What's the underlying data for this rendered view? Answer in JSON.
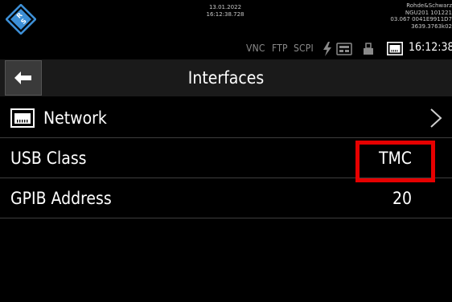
{
  "status_bar": {
    "capture_date": "13.01.2022",
    "capture_time": "16:12:38.728",
    "device_info": [
      "Rohde&Schwarz",
      "NGU201 101221",
      "03.067 0041E9911D7",
      "3639.3763k02"
    ],
    "remote_labels": [
      "VNC",
      "FTP",
      "SCPI"
    ],
    "clock": "16:12:38",
    "icons": [
      "rs-logo-icon",
      "lightning-icon",
      "usb-icon",
      "lock-icon",
      "network-icon"
    ]
  },
  "header": {
    "title": "Interfaces",
    "back_icon": "arrow-left-icon"
  },
  "rows": [
    {
      "label": "Network",
      "icon": "network-icon",
      "chevron": ">"
    },
    {
      "label": "USB Class",
      "value": "TMC"
    },
    {
      "label": "GPIB Address",
      "value": "20"
    }
  ],
  "colors": {
    "background": "#000000",
    "title_bar": "#1a1a1a",
    "text": "#ffffff",
    "muted_text": "#8a8a8a",
    "divider": "#3e3e3e",
    "highlight": "#e60000",
    "logo_blue": "#3d8fd6"
  }
}
